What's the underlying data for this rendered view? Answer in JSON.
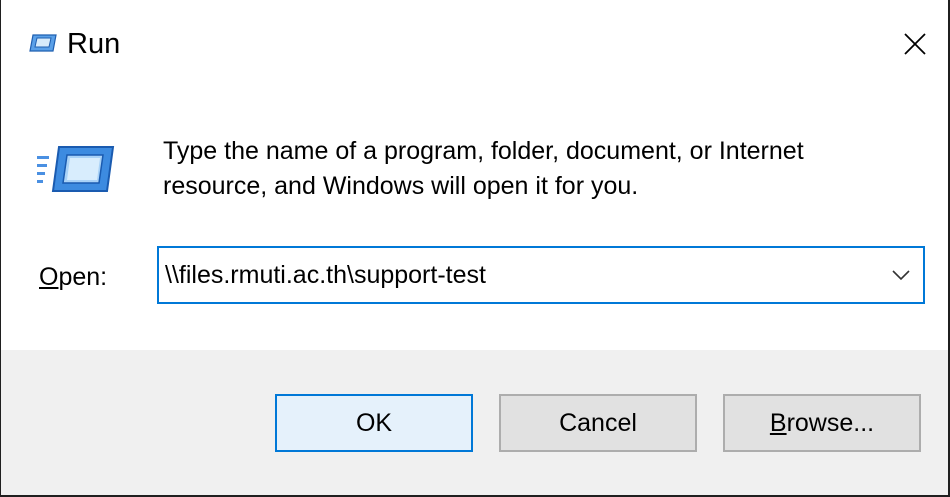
{
  "window": {
    "title": "Run",
    "icon": "run-icon",
    "close_icon": "close-icon"
  },
  "dialog": {
    "description_line1": "Type the name of a program, folder, document, or Internet",
    "description_line2": "resource, and Windows will open it for you.",
    "open_label_mnemonic": "O",
    "open_label_rest": "pen:",
    "open_value": "\\\\files.rmuti.ac.th\\support-test",
    "dropdown_icon": "chevron-down-icon"
  },
  "buttons": {
    "ok_label": "OK",
    "cancel_label": "Cancel",
    "browse_mnemonic": "B",
    "browse_rest": "rowse..."
  },
  "colors": {
    "accent": "#0078d7",
    "footer_bg": "#f0f0f0",
    "icon_blue": "#2b7bd6"
  }
}
